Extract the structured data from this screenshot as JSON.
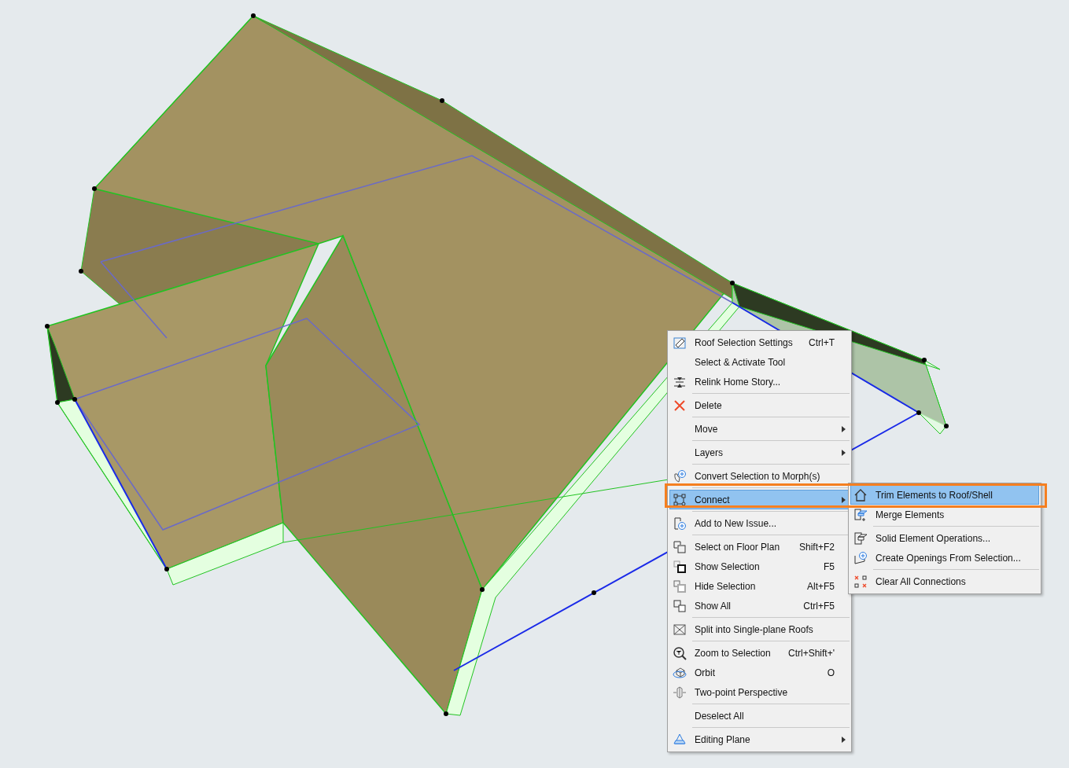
{
  "highlight_frame": true,
  "context_menu": {
    "items": [
      {
        "kind": "item",
        "label": "Roof Selection Settings",
        "shortcut": "Ctrl+T",
        "submenu": false,
        "selected": false
      },
      {
        "kind": "item",
        "label": "Select & Activate Tool",
        "submenu": false,
        "selected": false
      },
      {
        "kind": "item",
        "label": "Relink Home Story...",
        "submenu": false,
        "selected": false
      },
      {
        "kind": "separator"
      },
      {
        "kind": "item",
        "label": "Delete",
        "submenu": false,
        "selected": false
      },
      {
        "kind": "separator"
      },
      {
        "kind": "item",
        "label": "Move",
        "submenu": true,
        "selected": false
      },
      {
        "kind": "separator"
      },
      {
        "kind": "item",
        "label": "Layers",
        "submenu": true,
        "selected": false
      },
      {
        "kind": "separator"
      },
      {
        "kind": "item",
        "label": "Convert Selection to Morph(s)",
        "submenu": false,
        "selected": false
      },
      {
        "kind": "separator"
      },
      {
        "kind": "item",
        "label": "Connect",
        "submenu": true,
        "selected": true
      },
      {
        "kind": "separator"
      },
      {
        "kind": "item",
        "label": "Add to New Issue...",
        "submenu": false,
        "selected": false
      },
      {
        "kind": "separator"
      },
      {
        "kind": "item",
        "label": "Select on Floor Plan",
        "shortcut": "Shift+F2",
        "submenu": false,
        "selected": false
      },
      {
        "kind": "item",
        "label": "Show Selection",
        "shortcut": "F5",
        "submenu": false,
        "selected": false
      },
      {
        "kind": "item",
        "label": "Hide Selection",
        "shortcut": "Alt+F5",
        "submenu": false,
        "selected": false
      },
      {
        "kind": "item",
        "label": "Show All",
        "shortcut": "Ctrl+F5",
        "submenu": false,
        "selected": false
      },
      {
        "kind": "separator"
      },
      {
        "kind": "item",
        "label": "Split into Single-plane Roofs",
        "submenu": false,
        "selected": false
      },
      {
        "kind": "separator"
      },
      {
        "kind": "item",
        "label": "Zoom to Selection",
        "shortcut": "Ctrl+Shift+'",
        "submenu": false,
        "selected": false
      },
      {
        "kind": "item",
        "label": "Orbit",
        "shortcut": "O",
        "submenu": false,
        "selected": false
      },
      {
        "kind": "item",
        "label": "Two-point Perspective",
        "submenu": false,
        "selected": false
      },
      {
        "kind": "separator"
      },
      {
        "kind": "item",
        "label": "Deselect All",
        "submenu": false,
        "selected": false
      },
      {
        "kind": "separator"
      },
      {
        "kind": "item",
        "label": "Editing Plane",
        "submenu": true,
        "selected": false
      }
    ]
  },
  "submenu": {
    "items": [
      {
        "kind": "item",
        "label": "Trim Elements to Roof/Shell",
        "selected": true
      },
      {
        "kind": "item",
        "label": "Merge Elements",
        "selected": false
      },
      {
        "kind": "separator"
      },
      {
        "kind": "item",
        "label": "Solid Element Operations...",
        "selected": false
      },
      {
        "kind": "item",
        "label": "Create Openings From Selection...",
        "selected": false
      },
      {
        "kind": "separator"
      },
      {
        "kind": "item",
        "label": "Clear All Connections",
        "selected": false
      }
    ]
  }
}
